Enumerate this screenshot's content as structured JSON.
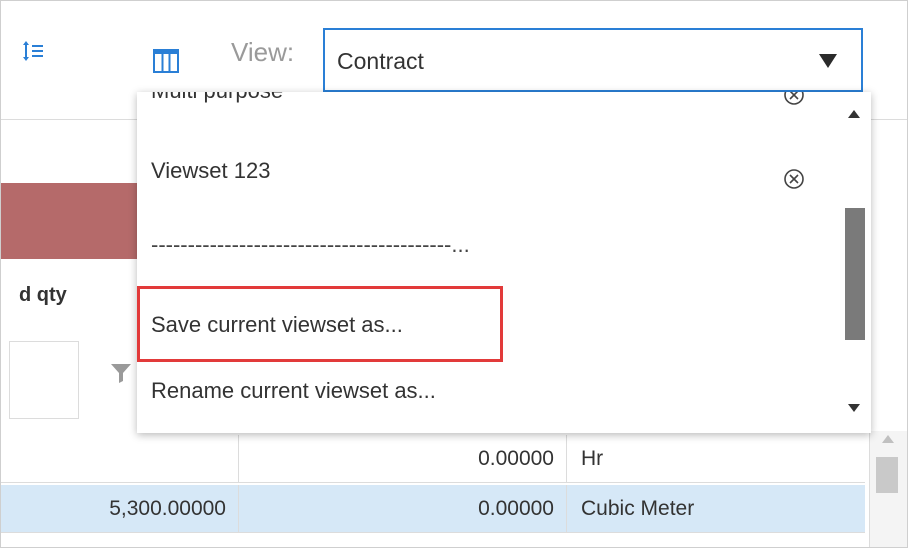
{
  "toolbar": {
    "row_height_icon": "row-height-icon",
    "columns_icon": "columns-icon",
    "view_label": "View:",
    "view_select": {
      "value": "Contract",
      "arrow_icon": "caret-down-icon"
    }
  },
  "dropdown": {
    "items": [
      {
        "label": "Multi purpose",
        "removable": true
      },
      {
        "label": "Viewset 123",
        "removable": true
      },
      {
        "label": "-----------------------------------------...",
        "removable": false
      },
      {
        "label": "Save current viewset as...",
        "removable": false,
        "highlighted": true
      },
      {
        "label": "Rename current viewset as...",
        "removable": false
      }
    ],
    "clear_icon": "circle-x-icon",
    "highlight_color": "#e23a3a"
  },
  "grid": {
    "column_header_partial": "d qty",
    "filter_icon": "funnel-icon",
    "rows": [
      {
        "c1": "",
        "c2": "0.00000",
        "c3": "Hr"
      },
      {
        "c1": "5,300.00000",
        "c2": "0.00000",
        "c3": "Cubic Meter"
      }
    ],
    "selected_row_color": "#d6e8f7",
    "band_color": "#b56a6a"
  },
  "colors": {
    "accent": "#2a7fd6",
    "label_gray": "#9a9a9a"
  }
}
